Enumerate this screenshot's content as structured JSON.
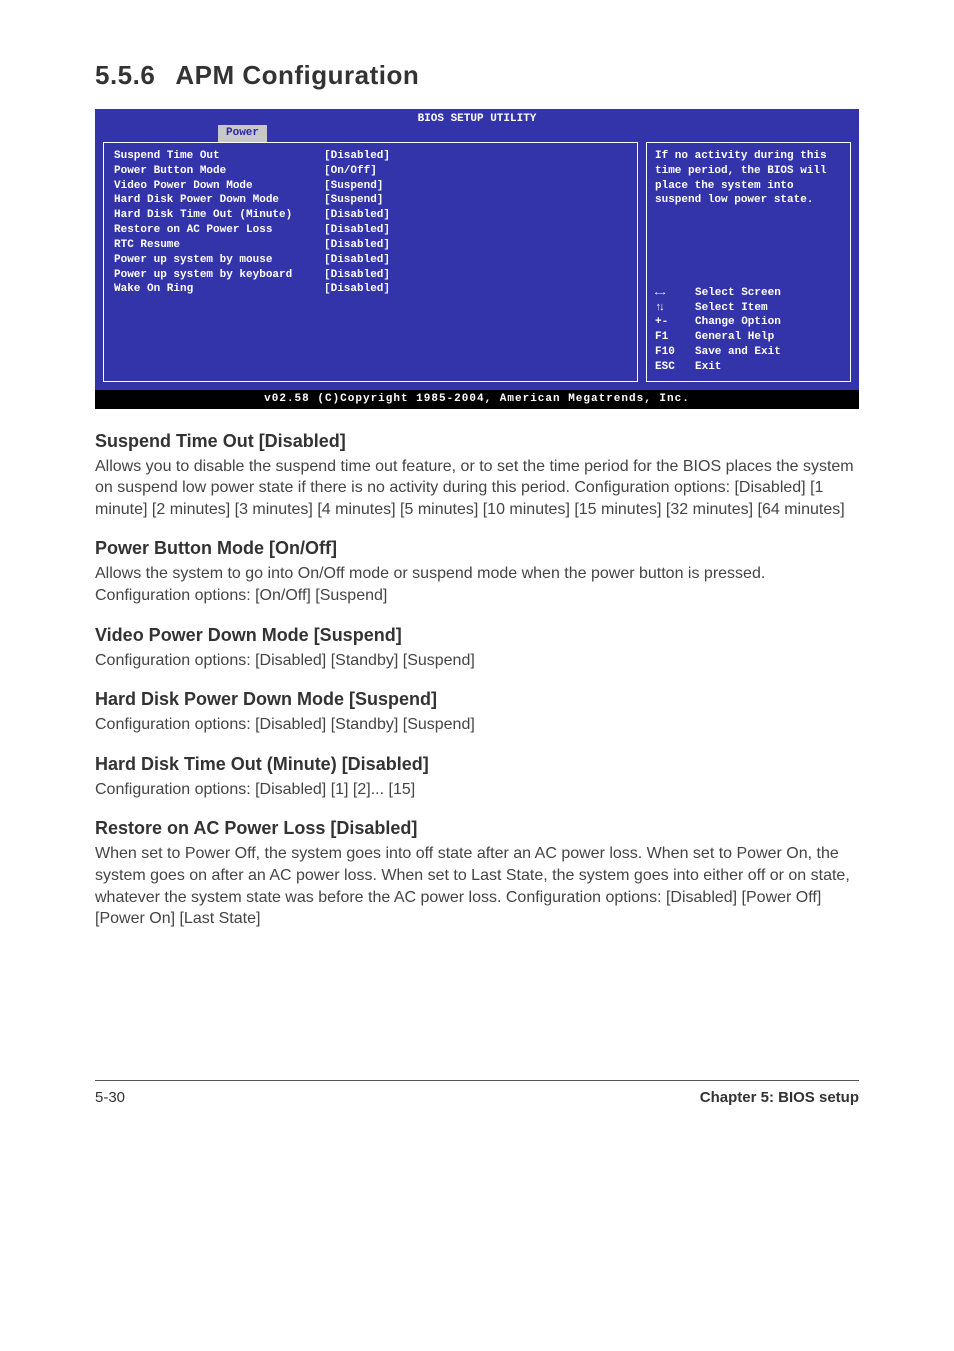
{
  "section": {
    "num": "5.5.6",
    "title": "APM Configuration"
  },
  "bios": {
    "title": "BIOS SETUP UTILITY",
    "tab": "Power",
    "items": [
      {
        "label": "Suspend Time Out",
        "value": "[Disabled]"
      },
      {
        "label": "Power Button Mode",
        "value": "[On/Off]"
      },
      {
        "label": "Video Power Down Mode",
        "value": "[Suspend]"
      },
      {
        "label": "Hard Disk Power Down Mode",
        "value": "[Suspend]"
      },
      {
        "label": "Hard Disk Time Out (Minute)",
        "value": "[Disabled]"
      },
      {
        "label": "Restore on AC Power Loss",
        "value": "[Disabled]"
      },
      {
        "label": "RTC Resume",
        "value": "[Disabled]"
      },
      {
        "label": "Power up system by mouse",
        "value": "[Disabled]"
      },
      {
        "label": "Power up system by keyboard",
        "value": "[Disabled]"
      },
      {
        "label": "Wake On Ring",
        "value": "[Disabled]"
      }
    ],
    "help": "If no activity during this time period, the BIOS will place the system into suspend low power state.",
    "keys": [
      {
        "sym": "lr",
        "label": "Select Screen"
      },
      {
        "sym": "ud",
        "label": "Select Item"
      },
      {
        "sym": "+-",
        "label": "Change Option"
      },
      {
        "sym": "F1",
        "label": "General Help"
      },
      {
        "sym": "F10",
        "label": "Save and Exit"
      },
      {
        "sym": "ESC",
        "label": "Exit"
      }
    ],
    "foot": "v02.58 (C)Copyright 1985-2004, American Megatrends, Inc."
  },
  "sections": [
    {
      "head": "Suspend Time Out [Disabled]",
      "body": "Allows you to disable the suspend time out feature, or to set the time period for the BIOS places the system on suspend low power state if there is no activity during this period. Configuration options: [Disabled] [1 minute] [2 minutes] [3 minutes] [4 minutes] [5 minutes] [10 minutes] [15 minutes] [32 minutes] [64 minutes]"
    },
    {
      "head": "Power Button Mode [On/Off]",
      "body": "Allows the system to go into On/Off mode or suspend mode when the power button is pressed. Configuration options: [On/Off] [Suspend]"
    },
    {
      "head": "Video Power Down Mode [Suspend]",
      "body": "Configuration options: [Disabled] [Standby] [Suspend]"
    },
    {
      "head": "Hard Disk Power Down Mode [Suspend]",
      "body": "Configuration options: [Disabled] [Standby] [Suspend]"
    },
    {
      "head": "Hard Disk Time Out (Minute) [Disabled]",
      "body": "Configuration options: [Disabled] [1] [2]... [15]"
    },
    {
      "head": "Restore on AC Power Loss [Disabled]",
      "body": "When set to Power Off, the system goes into off state after an AC power loss. When set to Power On, the system goes on after an AC power loss. When set to Last State, the system goes into either off or on state, whatever the system state was before the AC power loss. Configuration options: [Disabled] [Power Off] [Power On] [Last State]"
    }
  ],
  "footer": {
    "left": "5-30",
    "right": "Chapter 5: BIOS setup"
  }
}
